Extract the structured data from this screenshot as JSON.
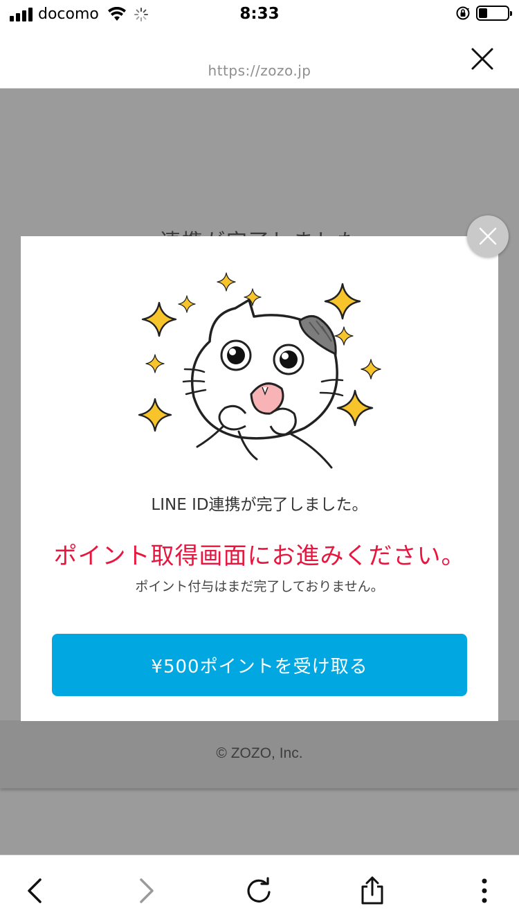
{
  "status_bar": {
    "carrier": "docomo",
    "time": "8:33",
    "battery_level": 0.3
  },
  "browser": {
    "url": "https://zozo.jp"
  },
  "background_page": {
    "heading": "連携が完了しました",
    "footer": "© ZOZO, Inc."
  },
  "modal": {
    "message_line1": "LINE ID連携が完了しました。",
    "message_line2": "ポイント取得画面にお進みください。",
    "message_line3": "ポイント付与はまだ完了しておりません。",
    "button_label": "¥500ポイントを受け取る",
    "accent_color": "#e8163f",
    "button_color": "#00a7e1"
  },
  "toolbar": {
    "icons": [
      "back-icon",
      "forward-icon",
      "reload-icon",
      "share-icon",
      "more-icon"
    ]
  }
}
